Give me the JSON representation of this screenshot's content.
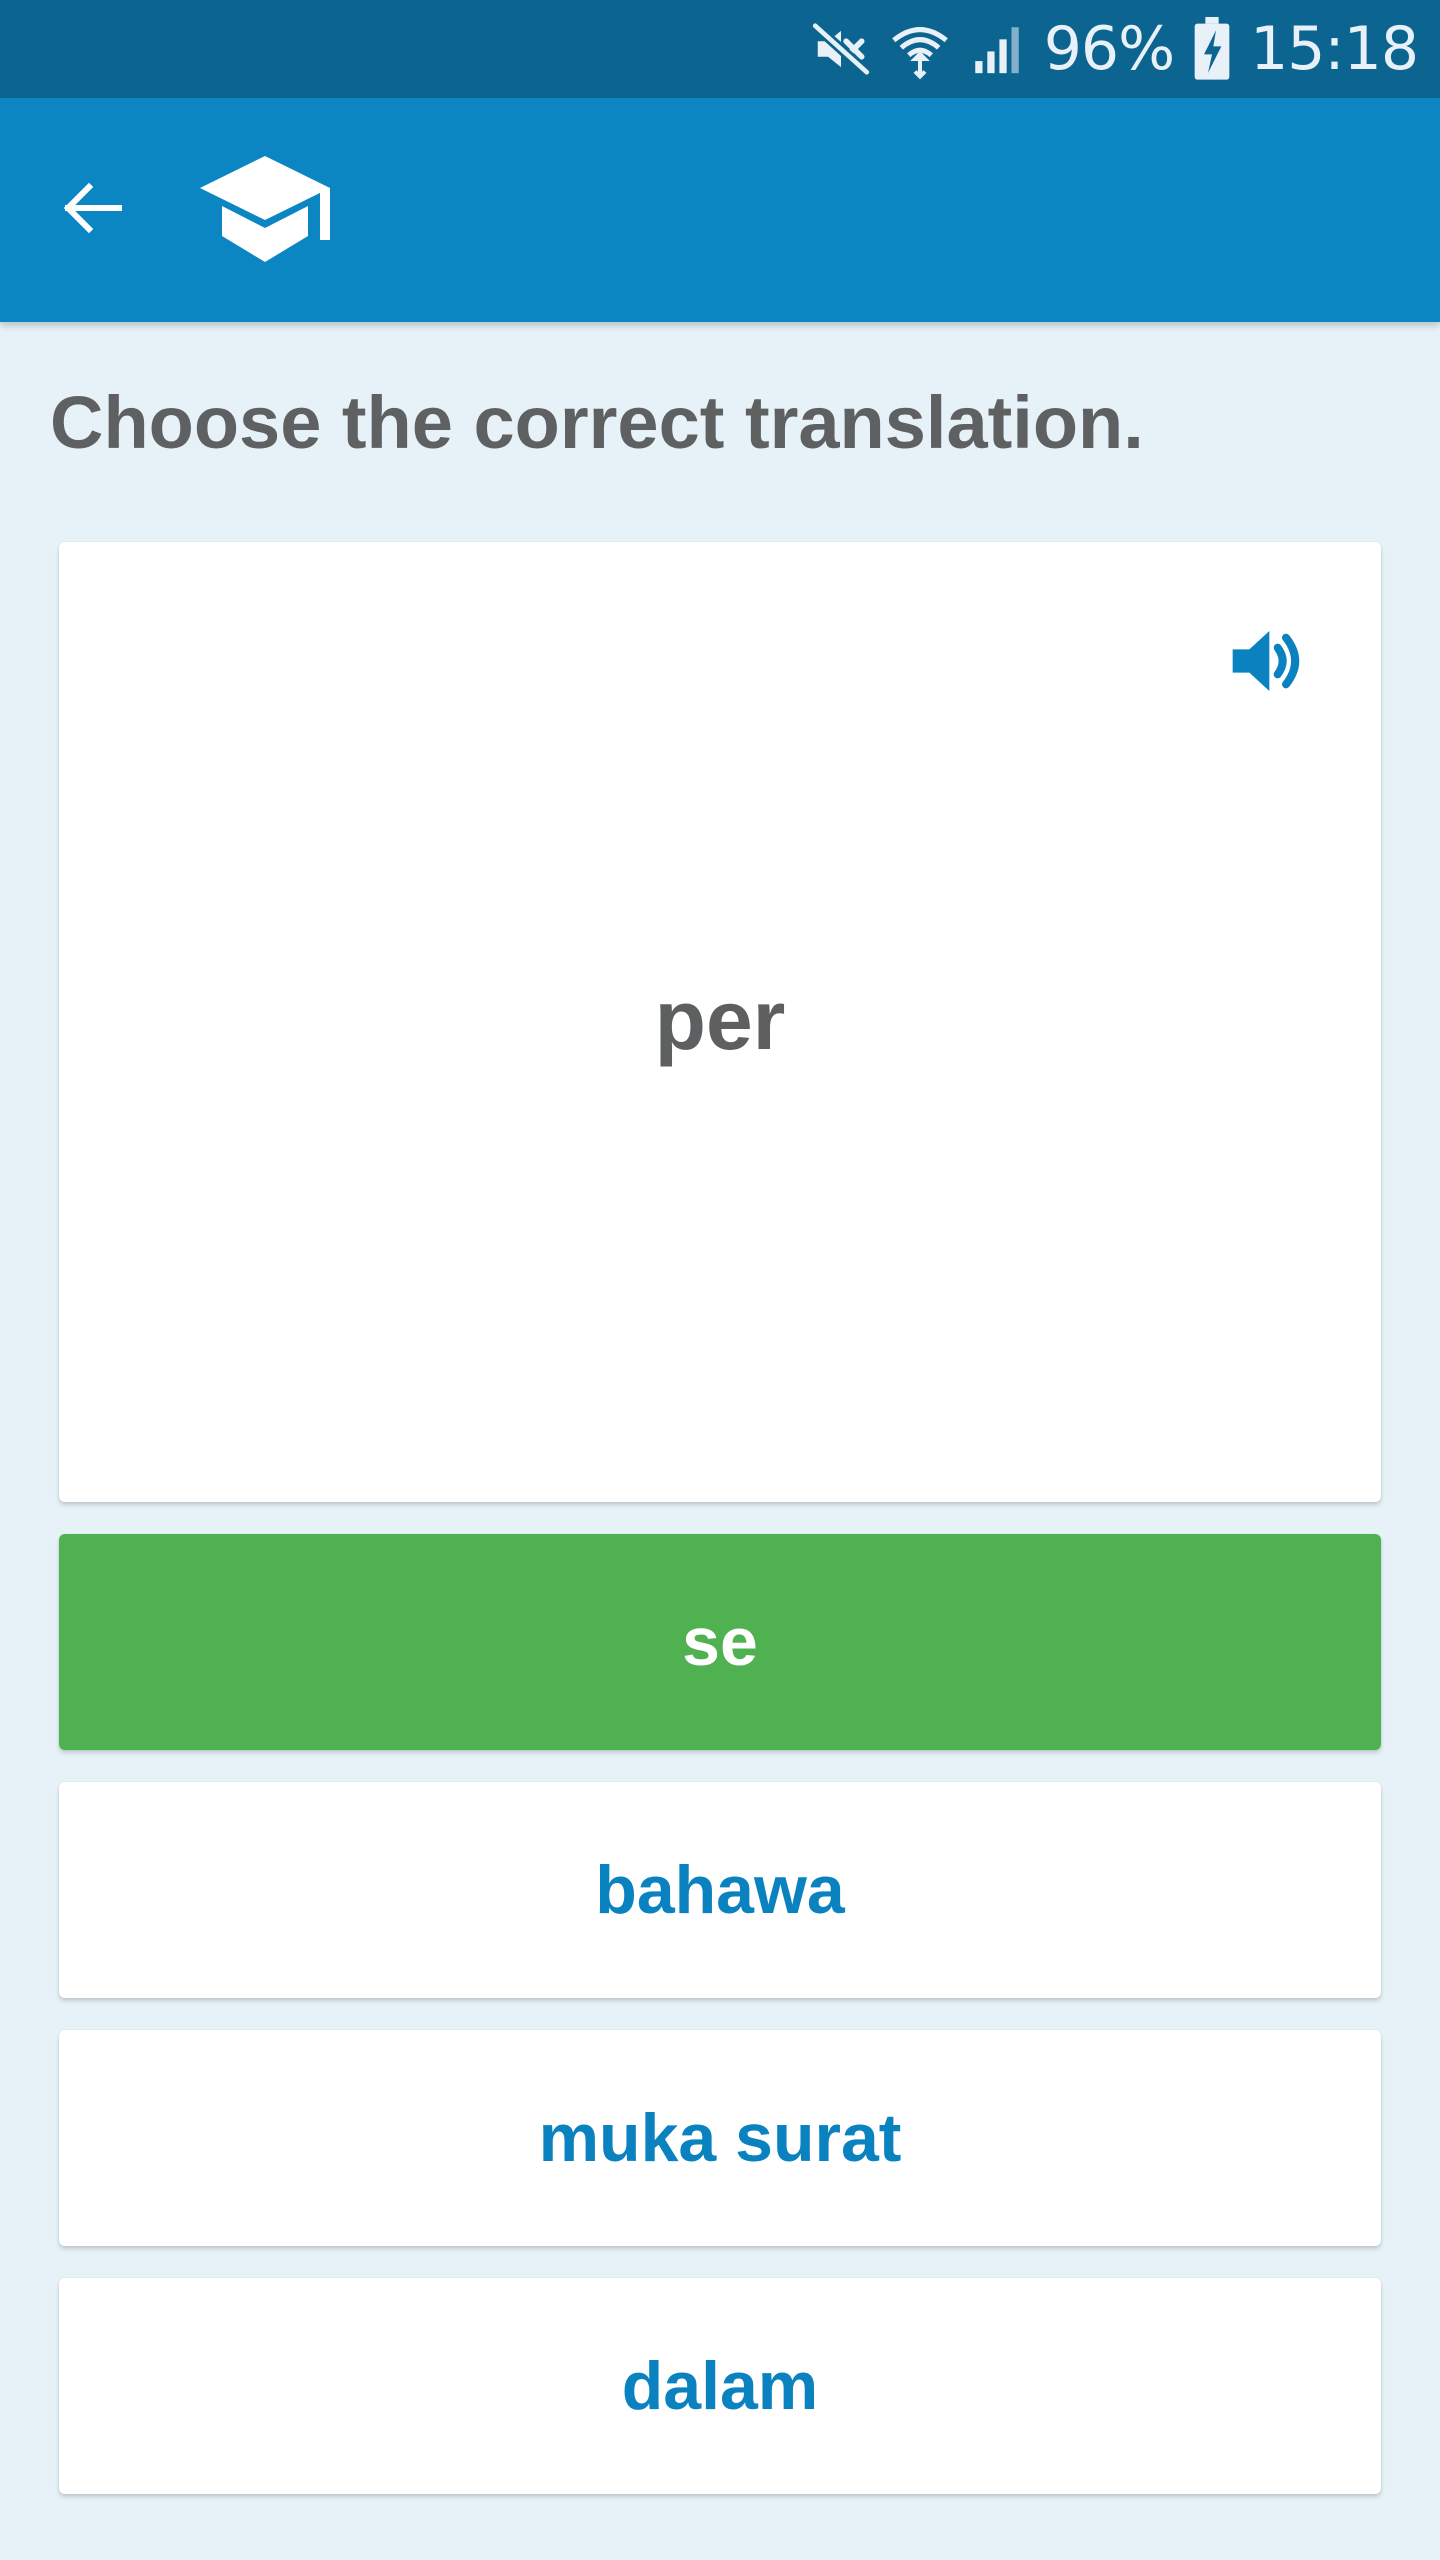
{
  "status_bar": {
    "battery": "96%",
    "time": "15:18",
    "icons": [
      "mute-icon",
      "wifi-icon",
      "signal-icon",
      "battery-charging-icon"
    ]
  },
  "app_bar": {
    "back_icon": "arrow-left-icon",
    "logo_icon": "graduation-cap-icon"
  },
  "quiz": {
    "instruction": "Choose the correct translation.",
    "word": "per",
    "speaker_icon": "speaker-icon",
    "options": [
      {
        "label": "se",
        "state": "correct"
      },
      {
        "label": "bahawa",
        "state": "normal"
      },
      {
        "label": "muka surat",
        "state": "normal"
      },
      {
        "label": "dalam",
        "state": "normal"
      }
    ]
  },
  "colors": {
    "status_bar": "#0b6590",
    "app_bar": "#0b86c3",
    "background": "#e6f2f8",
    "correct": "#4fb150",
    "option_text": "#0b82c0",
    "text_gray": "#5f6062"
  }
}
